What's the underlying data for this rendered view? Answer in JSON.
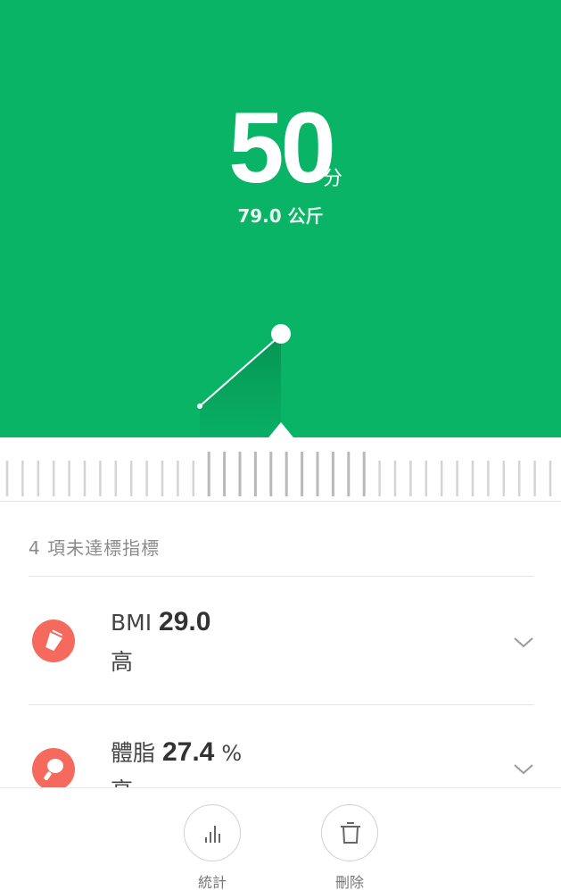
{
  "summary": {
    "score": "50",
    "score_unit": "分",
    "weight": "79.0 公斤"
  },
  "colors": {
    "hero_bg": "#09b467",
    "warning_icon": "#f56a5c"
  },
  "issues": {
    "header": "4 項未達標指標",
    "items": [
      {
        "icon": "bmi-icon",
        "name": "BMI",
        "value": "29.0",
        "unit": "",
        "status": "高"
      },
      {
        "icon": "body-fat-icon",
        "name": "體脂",
        "value": "27.4",
        "unit": "%",
        "status": "高"
      }
    ]
  },
  "actions": {
    "stats_label": "統計",
    "delete_label": "刪除"
  }
}
